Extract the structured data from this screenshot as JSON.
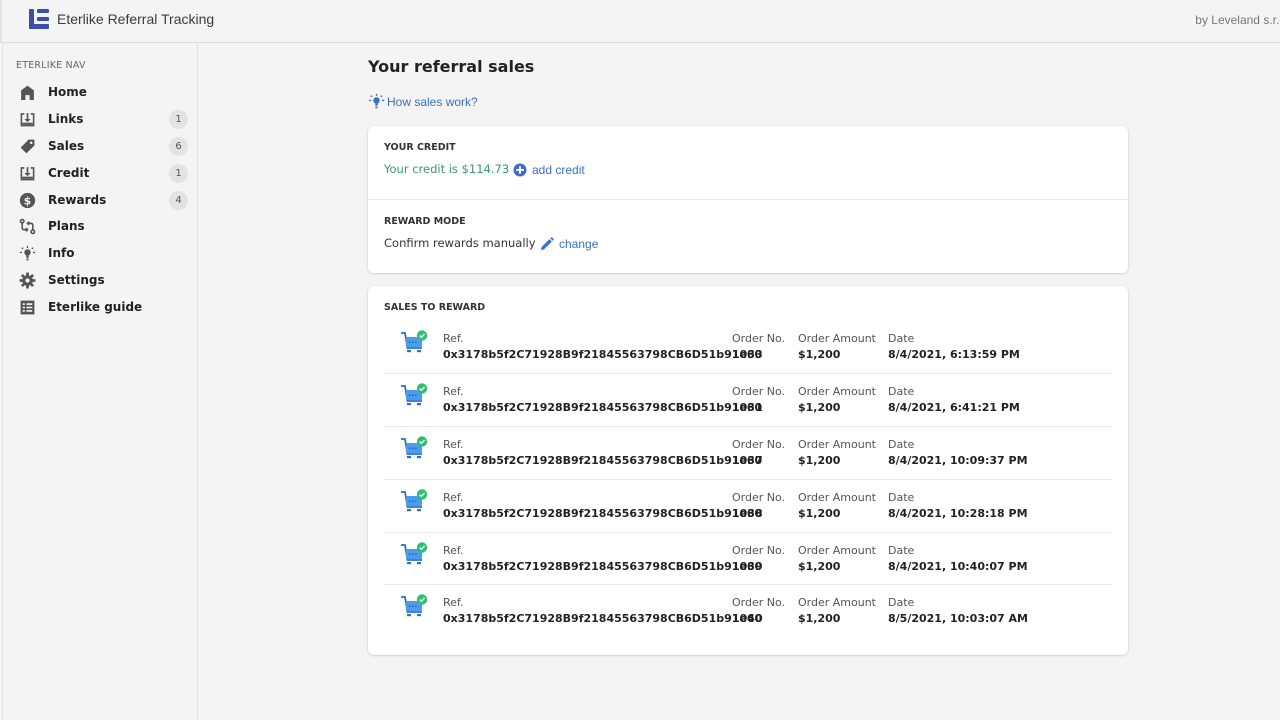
{
  "header": {
    "app_title": "Eterlike Referral Tracking",
    "byline": "by Leveland s.r.o",
    "brand_color": "#3b4fa8"
  },
  "sidebar": {
    "heading": "ETERLIKE NAV",
    "items": [
      {
        "label": "Home",
        "icon": "home-icon",
        "badge": null
      },
      {
        "label": "Links",
        "icon": "download-tray-icon",
        "badge": "1"
      },
      {
        "label": "Sales",
        "icon": "tag-icon",
        "badge": "6"
      },
      {
        "label": "Credit",
        "icon": "download-tray-icon",
        "badge": "1"
      },
      {
        "label": "Rewards",
        "icon": "dollar-circle-icon",
        "badge": "4"
      },
      {
        "label": "Plans",
        "icon": "swap-arrows-icon",
        "badge": null
      },
      {
        "label": "Info",
        "icon": "lightbulb-icon",
        "badge": null
      },
      {
        "label": "Settings",
        "icon": "gear-icon",
        "badge": null
      },
      {
        "label": "Eterlike guide",
        "icon": "list-icon",
        "badge": null
      }
    ]
  },
  "main": {
    "title": "Your referral sales",
    "help_link": "How sales work?",
    "credit": {
      "heading": "YOUR CREDIT",
      "text": "Your credit is $114.73",
      "action": "add credit"
    },
    "reward_mode": {
      "heading": "REWARD MODE",
      "text": "Confirm rewards manually",
      "action": "change"
    },
    "sales": {
      "heading": "SALES TO REWARD",
      "labels": {
        "ref": "Ref.",
        "order": "Order No.",
        "amount": "Order Amount",
        "date": "Date"
      },
      "rows": [
        {
          "ref": "0x3178b5f2C71928B9f21845563798CB6D51b91e60",
          "order": "1033",
          "amount": "$1,200",
          "date": "8/4/2021, 6:13:59 PM"
        },
        {
          "ref": "0x3178b5f2C71928B9f21845563798CB6D51b91e60",
          "order": "1031",
          "amount": "$1,200",
          "date": "8/4/2021, 6:41:21 PM"
        },
        {
          "ref": "0x3178b5f2C71928B9f21845563798CB6D51b91e60",
          "order": "1037",
          "amount": "$1,200",
          "date": "8/4/2021, 10:09:37 PM"
        },
        {
          "ref": "0x3178b5f2C71928B9f21845563798CB6D51b91e60",
          "order": "1038",
          "amount": "$1,200",
          "date": "8/4/2021, 10:28:18 PM"
        },
        {
          "ref": "0x3178b5f2C71928B9f21845563798CB6D51b91e60",
          "order": "1039",
          "amount": "$1,200",
          "date": "8/4/2021, 10:40:07 PM"
        },
        {
          "ref": "0x3178b5f2C71928B9f21845563798CB6D51b91e60",
          "order": "1040",
          "amount": "$1,200",
          "date": "8/5/2021, 10:03:07 AM"
        }
      ]
    }
  },
  "colors": {
    "link": "#3a6fc4",
    "credit_text": "#3a9a6b",
    "success_badge": "#2fbf71",
    "cart": "#3d8ee6"
  }
}
